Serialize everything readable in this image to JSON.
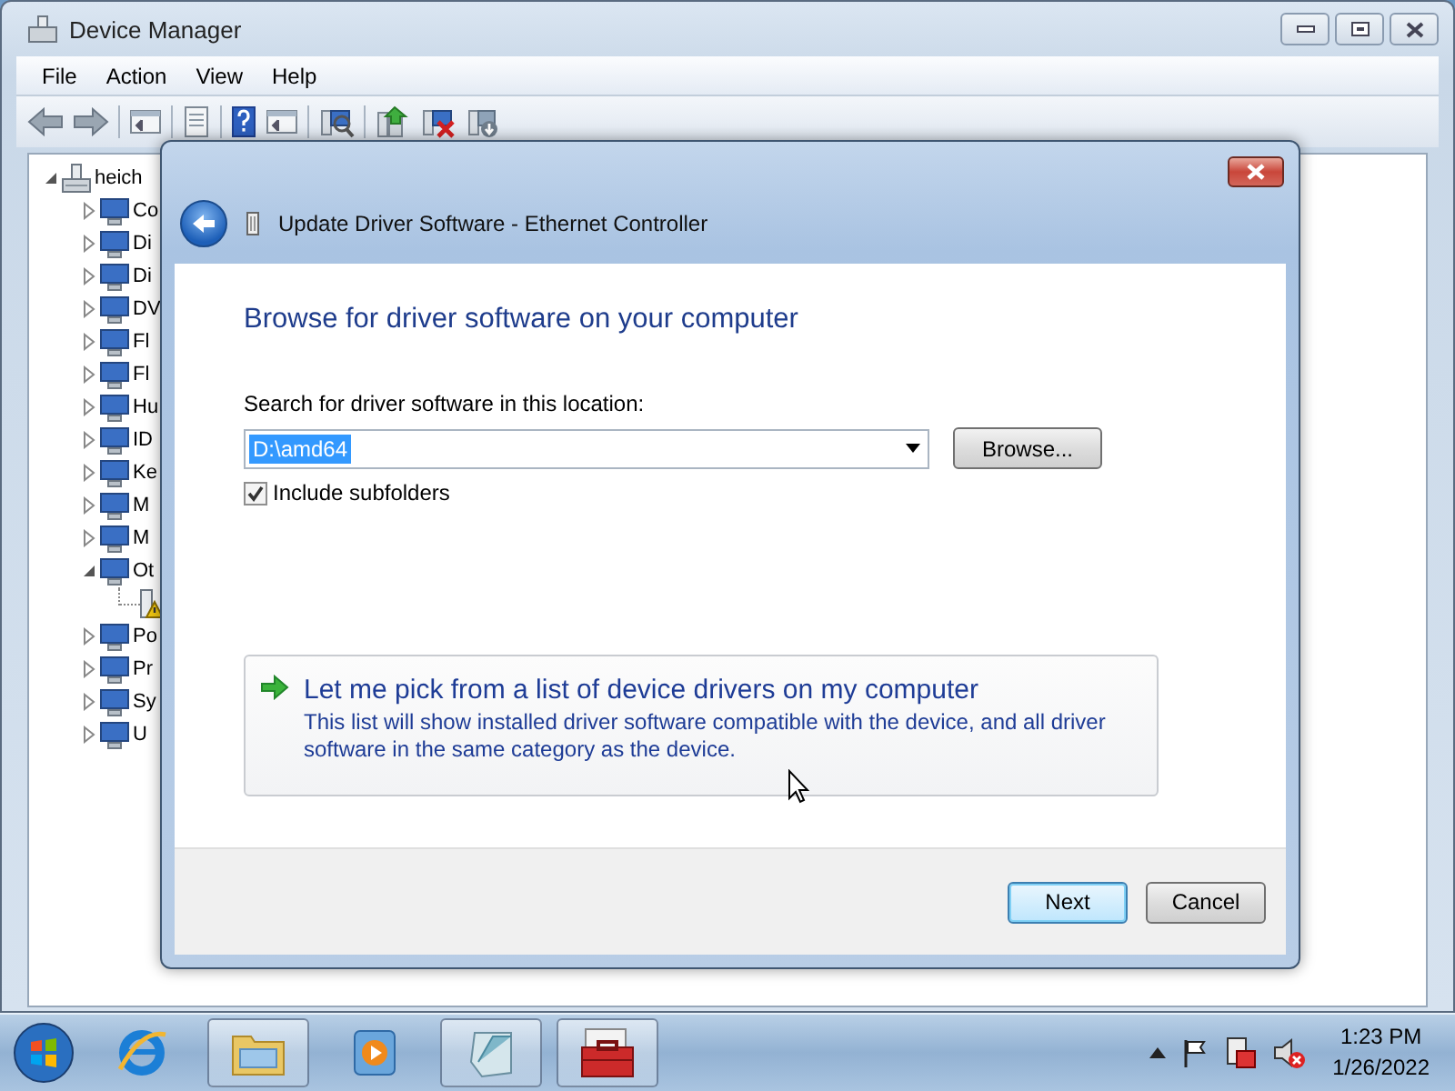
{
  "window": {
    "title": "Device Manager",
    "menu": [
      "File",
      "Action",
      "View",
      "Help"
    ]
  },
  "tree": {
    "items": [
      {
        "label": "heich",
        "kind": "computer",
        "expanded": true,
        "children": [
          {
            "label": "Co",
            "kind": "category",
            "expanded": false
          },
          {
            "label": "Di",
            "kind": "category",
            "expanded": false
          },
          {
            "label": "Di",
            "kind": "category",
            "expanded": false
          },
          {
            "label": "DV",
            "kind": "category",
            "expanded": false
          },
          {
            "label": "Fl",
            "kind": "category",
            "expanded": false
          },
          {
            "label": "Fl",
            "kind": "category",
            "expanded": false
          },
          {
            "label": "Hu",
            "kind": "category",
            "expanded": false
          },
          {
            "label": "ID",
            "kind": "category",
            "expanded": false
          },
          {
            "label": "Ke",
            "kind": "category",
            "expanded": false
          },
          {
            "label": "M",
            "kind": "category",
            "expanded": false
          },
          {
            "label": "M",
            "kind": "category",
            "expanded": false
          },
          {
            "label": "Ot",
            "kind": "category",
            "expanded": true,
            "children": [
              {
                "kind": "warning"
              }
            ]
          },
          {
            "label": "Po",
            "kind": "category",
            "expanded": false
          },
          {
            "label": "Pr",
            "kind": "category",
            "expanded": false
          },
          {
            "label": "Sy",
            "kind": "category",
            "expanded": false
          },
          {
            "label": "U",
            "kind": "category",
            "expanded": false
          }
        ]
      }
    ]
  },
  "dialog": {
    "title": "Update Driver Software - Ethernet Controller",
    "heading": "Browse for driver software on your computer",
    "location_label": "Search for driver software in this location:",
    "location": {
      "value": "D:\\amd64",
      "highlighted": true
    },
    "browse_button": "Browse...",
    "include_subfolders": {
      "label": "Include subfolders",
      "checked": true
    },
    "option": {
      "title": "Let me pick from a list of device drivers on my computer",
      "description": "This list will show installed driver software compatible with the device, and all driver software in the same category as the device."
    },
    "buttons": [
      {
        "label": "Next",
        "default": true
      },
      {
        "label": "Cancel",
        "default": false
      }
    ]
  },
  "taskbar": {
    "apps": [
      {
        "kind": "browser",
        "running": false
      },
      {
        "kind": "folder",
        "running": true
      },
      {
        "kind": "media",
        "running": false
      },
      {
        "kind": "notepad",
        "running": true
      },
      {
        "kind": "toolbox",
        "running": true
      }
    ],
    "time": "1:23 PM",
    "date": "1/26/2022"
  }
}
